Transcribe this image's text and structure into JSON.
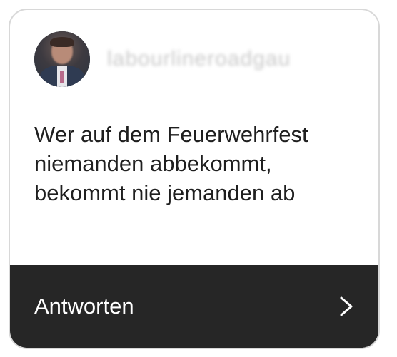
{
  "card": {
    "username": "labourlineroadgau",
    "message": "Wer auf dem Feuerwehrfest niemanden abbekommt, bekommt nie jemanden ab",
    "reply_label": "Antworten"
  },
  "icons": {
    "avatar": "profile-avatar",
    "reply": "chevron-right-icon"
  },
  "colors": {
    "card_background": "#ffffff",
    "reply_bar_background": "#262626",
    "text_primary": "#1f1f1f",
    "reply_text": "#ffffff"
  }
}
